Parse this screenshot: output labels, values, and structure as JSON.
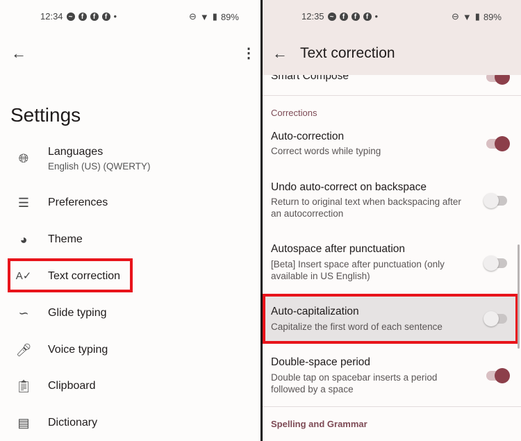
{
  "left": {
    "status": {
      "time": "12:34",
      "battery": "89%"
    },
    "title": "Settings",
    "items": [
      {
        "label": "Languages",
        "sub": "English (US) (QWERTY)",
        "icon": "globe-icon"
      },
      {
        "label": "Preferences",
        "icon": "sliders-icon"
      },
      {
        "label": "Theme",
        "icon": "palette-icon"
      },
      {
        "label": "Text correction",
        "icon": "spellcheck-icon"
      },
      {
        "label": "Glide typing",
        "icon": "gesture-icon"
      },
      {
        "label": "Voice typing",
        "icon": "mic-icon"
      },
      {
        "label": "Clipboard",
        "icon": "clipboard-icon"
      },
      {
        "label": "Dictionary",
        "icon": "book-icon"
      }
    ]
  },
  "right": {
    "status": {
      "time": "12:35",
      "battery": "89%"
    },
    "title": "Text correction",
    "smart_compose": "Smart Compose",
    "section_corrections": "Corrections",
    "items": [
      {
        "title": "Auto-correction",
        "sub": "Correct words while typing",
        "on": true
      },
      {
        "title": "Undo auto-correct on backspace",
        "sub": "Return to original text when backspacing after an autocorrection",
        "on": false
      },
      {
        "title": "Autospace after punctuation",
        "sub": "[Beta] Insert space after punctuation (only available in US English)",
        "on": false
      },
      {
        "title": "Auto-capitalization",
        "sub": "Capitalize the first word of each sentence",
        "on": false
      },
      {
        "title": "Double-space period",
        "sub": "Double tap on spacebar inserts a period followed by a space",
        "on": true
      }
    ],
    "section_spelling": "Spelling and Grammar"
  },
  "colors": {
    "accent": "#8c3f4a",
    "highlight": "#e8141b"
  }
}
